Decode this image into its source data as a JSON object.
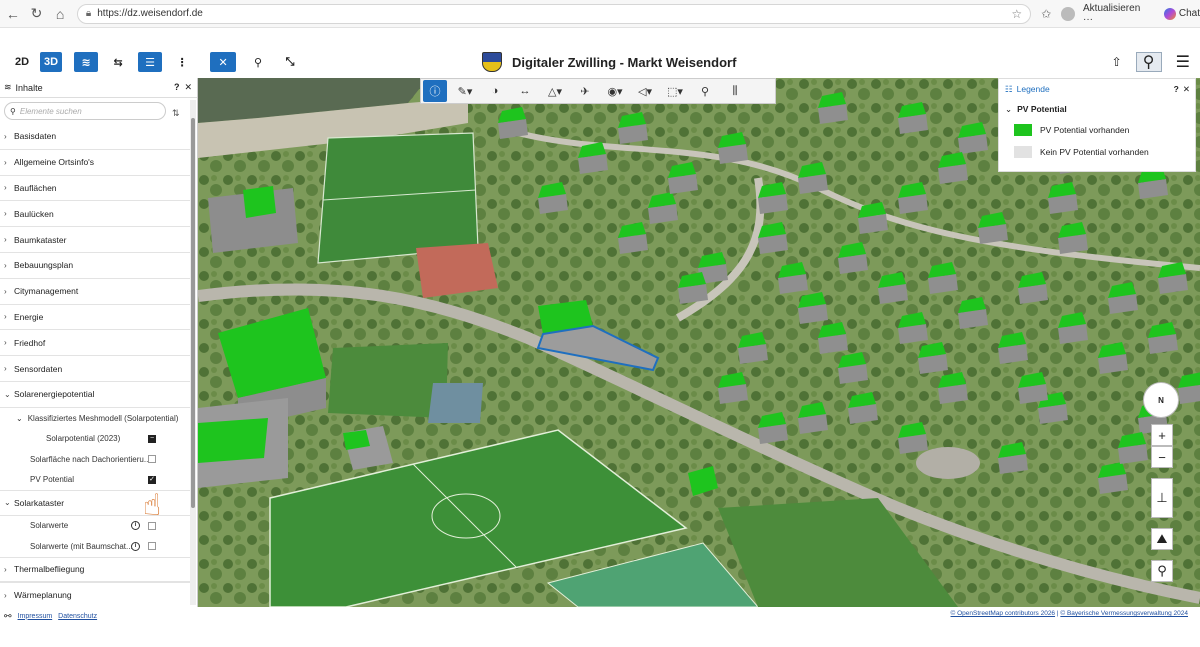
{
  "browser": {
    "url": "https://dz.weisendorf.de",
    "update_label": "Aktualisieren",
    "update_more": "···",
    "chat_label": "Chat"
  },
  "toolbar": {
    "btn_2d": "2D",
    "btn_3d": "3D"
  },
  "app": {
    "title": "Digitaler Zwilling - Markt Weisendorf"
  },
  "sidebar": {
    "title": "Inhalte",
    "search_placeholder": "Elemente suchen",
    "items": [
      {
        "label": "Basisdaten"
      },
      {
        "label": "Allgemeine Ortsinfo's"
      },
      {
        "label": "Bauflächen"
      },
      {
        "label": "Baulücken"
      },
      {
        "label": "Baumkataster"
      },
      {
        "label": "Bebauungsplan"
      },
      {
        "label": "Citymanagement"
      },
      {
        "label": "Energie"
      },
      {
        "label": "Friedhof"
      },
      {
        "label": "Sensordaten"
      },
      {
        "label": "Solarenergiepotential"
      }
    ],
    "solar": {
      "mesh": "Klassifiziertes Meshmodell (Solarpotential)",
      "potential2023": "Solarpotential (2023)",
      "dach": "Solarfläche nach Dachorientieru...",
      "pv": "PV Potential"
    },
    "kataster": {
      "label": "Solarkataster",
      "werte": "Solarwerte",
      "werte_baum": "Solarwerte (mit Baumschat..."
    },
    "bottom_items": [
      {
        "label": "Thermalbefliegung"
      },
      {
        "label": "Wärmeplanung"
      }
    ]
  },
  "legend": {
    "title": "Legende",
    "section": "PV Potential",
    "items": [
      {
        "label": "PV Potential vorhanden",
        "color": "#1ec41e"
      },
      {
        "label": "Kein PV Potential vorhanden",
        "color": "#e2e2e2"
      }
    ]
  },
  "map_controls": {
    "compass": "N"
  },
  "footer": {
    "impressum": "Impressum",
    "datenschutz": "Datenschutz",
    "osm": "© OpenStreetMap contributors 2026",
    "bvv": "© Bayerische Vermessungsverwaltung 2024"
  }
}
